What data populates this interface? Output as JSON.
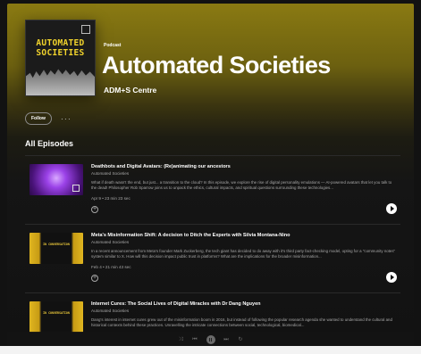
{
  "podcast": {
    "kind_label": "Podcast",
    "title": "Automated Societies",
    "publisher": "ADM+S Centre",
    "cover_title_line1": "AUTOMATED",
    "cover_title_line2": "SOCIETIES"
  },
  "actions": {
    "follow_label": "Follow",
    "more_label": "···"
  },
  "episodes_section": {
    "title": "All Episodes"
  },
  "episodes": [
    {
      "title": "Deathbots and Digital Avatars: (Re)animating our ancestors",
      "show": "Automated Societies",
      "description": "What if death wasn't the end, but just... a transition to the cloud? In this episode, we explore the rise of digital personality emulations — AI-powered avatars that let you talk to the dead! Philosopher Rob Sparrow joins us to unpack the ethics, cultural impacts, and spiritual questions surrounding these technologies...",
      "meta": "Apr 9 • 23 min 23 sec",
      "thumb": "violet",
      "add_icon": "plus-circle-icon",
      "play_icon": "play-icon"
    },
    {
      "title": "Meta's Misinformation Shift: A decision to Ditch the Experts with Silvia Montana-Nino",
      "show": "Automated Societies",
      "description": "In a recent announcement from Meta's founder Mark Zuckerberg, the tech giant has decided to do away with it's third party fact-checking model, opting for a \"community notes\" system similar to X. How will this decision impact public trust in platforms? What are the implications for the broader misinformation...",
      "meta": "Feb 4 • 21 min 43 sec",
      "thumb": "yellow",
      "thumb_text": "IN CONVERSATION",
      "add_icon": "plus-circle-icon",
      "play_icon": "play-icon"
    },
    {
      "title": "Internet Cures: The Social Lives of Digital Miracles with Dr Dang Nguyen",
      "show": "Automated Societies",
      "description": "Dang's interest in internet cures grew out of the misinformation boom in 2016, but instead of following the popular research agenda she wanted to understand the cultural and historical contexts behind these practices. Unravelling the intricate connections between social, technological, biomedical...",
      "meta": "",
      "thumb": "yellow",
      "thumb_text": "IN CONVERSATION",
      "add_icon": "plus-circle-icon",
      "play_icon": "play-icon"
    }
  ],
  "player": {
    "icons": [
      "shuffle-icon",
      "previous-icon",
      "play-pause-icon",
      "next-icon",
      "repeat-icon"
    ]
  },
  "colors": {
    "hero_gold": "#8a7a12",
    "accent_yellow": "#f2d42c",
    "background": "#121212"
  }
}
